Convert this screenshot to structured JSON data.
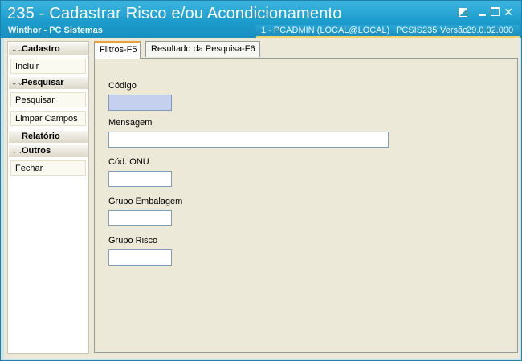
{
  "window": {
    "title": "235 - Cadastrar Risco e/ou Acondicionamento",
    "subtitle": "Winthor - PC Sistemas",
    "status": {
      "connection": "1 - PCADMIN (LOCAL@LOCAL)",
      "module": "PCSIS235",
      "version_label": "Versão",
      "version": "29.0.02.000"
    },
    "controls": {
      "restore_icon": "restore-icon",
      "minimize_icon": "minimize-icon",
      "maximize_icon": "maximize-icon",
      "close_icon": "close-icon"
    }
  },
  "sidebar": {
    "groups": [
      {
        "label": "Cadastro",
        "items": [
          "Incluir"
        ]
      },
      {
        "label": "Pesquisar",
        "items": [
          "Pesquisar",
          "Limpar Campos"
        ]
      },
      {
        "label": "Relatório",
        "items": []
      },
      {
        "label": "Outros",
        "items": [
          "Fechar"
        ]
      }
    ]
  },
  "tabs": [
    {
      "label": "Filtros-F5",
      "active": true
    },
    {
      "label": "Resultado da Pesquisa-F6",
      "active": false
    }
  ],
  "filters": {
    "codigo": {
      "label": "Código",
      "value": ""
    },
    "mensagem": {
      "label": "Mensagem",
      "value": ""
    },
    "cod_onu": {
      "label": "Cód. ONU",
      "value": ""
    },
    "grupo_embalagem": {
      "label": "Grupo Embalagem",
      "value": ""
    },
    "grupo_risco": {
      "label": "Grupo Risco",
      "value": ""
    }
  },
  "colors": {
    "titlebar": "#1c9ccc",
    "accent_strip": "#f2d26a",
    "focused_field": "#c5d0ee",
    "active_tab_marker": "#e6a23c"
  }
}
